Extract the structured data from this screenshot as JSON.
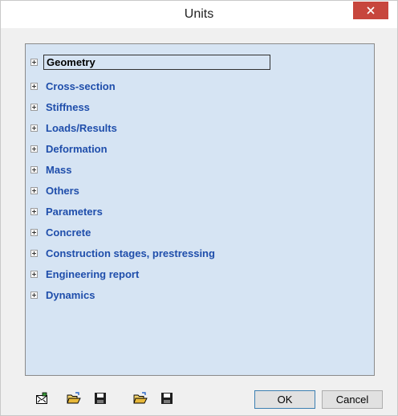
{
  "window": {
    "title": "Units"
  },
  "tree": {
    "items": [
      {
        "label": "Geometry",
        "selected": true
      },
      {
        "label": "Cross-section"
      },
      {
        "label": "Stiffness"
      },
      {
        "label": "Loads/Results"
      },
      {
        "label": "Deformation"
      },
      {
        "label": "Mass"
      },
      {
        "label": "Others"
      },
      {
        "label": "Parameters"
      },
      {
        "label": "Concrete"
      },
      {
        "label": "Construction stages, prestressing"
      },
      {
        "label": "Engineering report"
      },
      {
        "label": "Dynamics"
      }
    ]
  },
  "toolbar": {
    "icons": [
      "reset-icon",
      "open-folder-icon",
      "save-disk-icon",
      "open-folder-icon",
      "save-disk-icon"
    ]
  },
  "buttons": {
    "ok": "OK",
    "cancel": "Cancel"
  },
  "colors": {
    "tree_background": "#d6e4f3",
    "tree_text": "#1f4eab",
    "close_button": "#c7463d"
  }
}
